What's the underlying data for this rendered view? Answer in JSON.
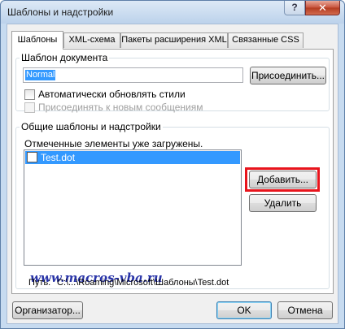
{
  "window": {
    "title": "Шаблоны и надстройки",
    "help_glyph": "?",
    "close_glyph": "✕"
  },
  "tabs": [
    {
      "label": "Шаблоны",
      "active": true
    },
    {
      "label": "XML-схема",
      "active": false
    },
    {
      "label": "Пакеты расширения XML",
      "active": false
    },
    {
      "label": "Связанные CSS",
      "active": false
    }
  ],
  "document_template": {
    "group_label": "Шаблон документа",
    "value": "Normal",
    "attach_button": "Присоединить...",
    "auto_update_label": "Автоматически обновлять стили",
    "auto_update_checked": false,
    "attach_new_mail_label": "Присоединять к новым сообщениям",
    "attach_new_mail_checked": false
  },
  "global_templates": {
    "group_label": "Общие шаблоны и надстройки",
    "loaded_note": "Отмеченные элементы уже загружены.",
    "items": [
      {
        "name": "Test.dot",
        "checked": false,
        "selected": true
      }
    ],
    "add_button": "Добавить...",
    "remove_button": "Удалить",
    "watermark": "www.macros-vba.ru",
    "path_label": "Путь:",
    "path_value": "C:\\...\\Roaming\\Microsoft\\Шаблоны\\Test.dot"
  },
  "footer": {
    "organizer_button": "Организатор...",
    "ok_button": "OK",
    "cancel_button": "Отмена"
  },
  "colors": {
    "highlight": "#e8141c",
    "selection": "#3399ff",
    "watermark": "#2a35a8"
  }
}
